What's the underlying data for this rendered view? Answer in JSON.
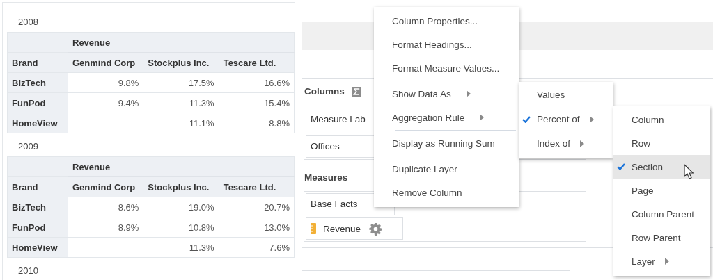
{
  "sections": [
    {
      "year": "2008",
      "table": {
        "measure": "Revenue",
        "row_header": "Brand",
        "columns": [
          "Genmind Corp",
          "Stockplus Inc.",
          "Tescare Ltd."
        ],
        "rows": [
          {
            "brand": "BizTech",
            "values": [
              "9.8%",
              "17.5%",
              "16.6%"
            ]
          },
          {
            "brand": "FunPod",
            "values": [
              "9.4%",
              "11.3%",
              "15.4%"
            ]
          },
          {
            "brand": "HomeView",
            "values": [
              "11.1%",
              "8.8%"
            ]
          }
        ]
      }
    },
    {
      "year": "2009",
      "table": {
        "measure": "Revenue",
        "row_header": "Brand",
        "columns": [
          "Genmind Corp",
          "Stockplus Inc.",
          "Tescare Ltd."
        ],
        "rows": [
          {
            "brand": "BizTech",
            "values": [
              "8.6%",
              "19.0%",
              "20.7%"
            ]
          },
          {
            "brand": "FunPod",
            "values": [
              "8.9%",
              "10.8%",
              "13.0%"
            ]
          },
          {
            "brand": "HomeView",
            "values": [
              "11.3%",
              "7.6%"
            ]
          }
        ]
      }
    },
    {
      "year": "2010"
    }
  ],
  "columns_section": {
    "title": "Columns",
    "items": [
      "Measure Lab",
      "Offices"
    ]
  },
  "measures_section": {
    "title": "Measures",
    "items": [
      {
        "label": "Base Facts",
        "kind": "folder"
      },
      {
        "label": "Revenue",
        "kind": "measure"
      }
    ]
  },
  "context_menu": [
    {
      "label": "Column Properties...",
      "has_submenu": false,
      "separator_before": false
    },
    {
      "label": "Format Headings...",
      "has_submenu": false,
      "separator_before": false
    },
    {
      "label": "Format Measure Values...",
      "has_submenu": false,
      "separator_before": false
    },
    {
      "label": "Show Data As",
      "has_submenu": true,
      "separator_before": true
    },
    {
      "label": "Aggregation Rule",
      "has_submenu": true,
      "separator_before": false
    },
    {
      "label": "Display as Running Sum",
      "has_submenu": false,
      "separator_before": true
    },
    {
      "label": "Duplicate Layer",
      "has_submenu": false,
      "separator_before": true
    },
    {
      "label": "Remove Column",
      "has_submenu": false,
      "separator_before": false
    }
  ],
  "show_data_as_menu": [
    {
      "label": "Values",
      "checked": false,
      "has_submenu": false
    },
    {
      "label": "Percent of",
      "checked": true,
      "has_submenu": true
    },
    {
      "label": "Index of",
      "checked": false,
      "has_submenu": true
    }
  ],
  "percent_of_menu": [
    {
      "label": "Column",
      "checked": false,
      "selected": false,
      "has_submenu": false
    },
    {
      "label": "Row",
      "checked": false,
      "selected": false,
      "has_submenu": false
    },
    {
      "label": "Section",
      "checked": true,
      "selected": true,
      "has_submenu": false
    },
    {
      "label": "Page",
      "checked": false,
      "selected": false,
      "has_submenu": false
    },
    {
      "label": "Column Parent",
      "checked": false,
      "selected": false,
      "has_submenu": false
    },
    {
      "label": "Row Parent",
      "checked": false,
      "selected": false,
      "has_submenu": false
    },
    {
      "label": "Layer",
      "checked": false,
      "selected": false,
      "has_submenu": true
    }
  ]
}
